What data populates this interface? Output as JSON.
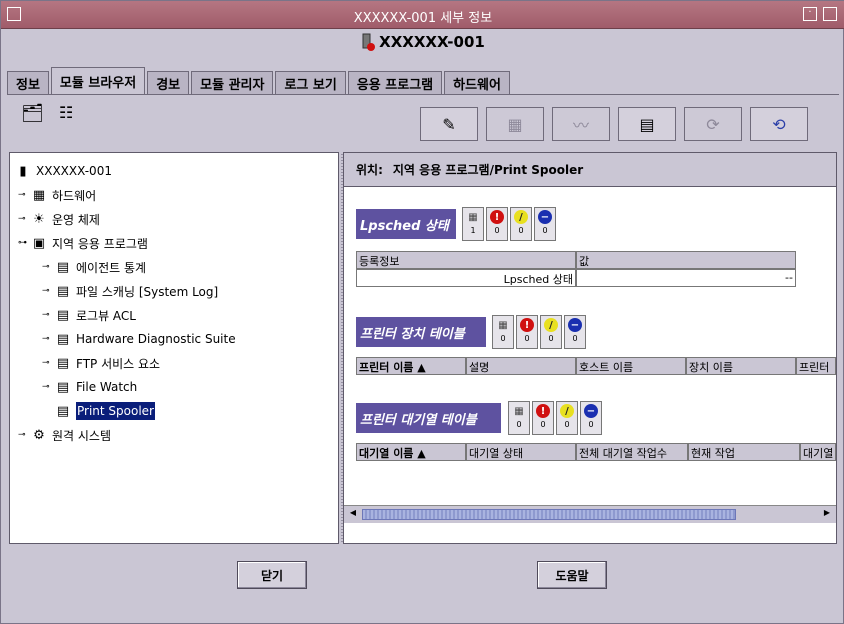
{
  "window": {
    "title": "XXXXXX-001 세부 정보"
  },
  "header": {
    "host": "XXXXXX-001"
  },
  "tabs": [
    {
      "label": "정보"
    },
    {
      "label": "모듈 브라우저"
    },
    {
      "label": "경보"
    },
    {
      "label": "모듈 관리자"
    },
    {
      "label": "로그 보기"
    },
    {
      "label": "응용 프로그램"
    },
    {
      "label": "하드웨어"
    }
  ],
  "tree": {
    "items": [
      {
        "label": "XXXXXX-001"
      },
      {
        "label": "하드웨어"
      },
      {
        "label": "운영 체제"
      },
      {
        "label": "지역 응용 프로그램"
      },
      {
        "label": "에이전트 통계"
      },
      {
        "label": "파일 스캐닝 [System Log]"
      },
      {
        "label": "로그뷰 ACL"
      },
      {
        "label": "Hardware Diagnostic Suite"
      },
      {
        "label": "FTP 서비스 요소"
      },
      {
        "label": "File Watch"
      },
      {
        "label": "Print Spooler"
      },
      {
        "label": "원격 시스템"
      }
    ]
  },
  "location": {
    "label": "위치:",
    "path": "지역 응용 프로그램/Print Spooler"
  },
  "sections": [
    {
      "title": "Lpsched 상태",
      "counts": [
        "1",
        "0",
        "0",
        "0"
      ],
      "headers": [
        "등록정보",
        "값"
      ],
      "row": [
        "Lpsched 상태",
        "--"
      ]
    },
    {
      "title": "프린터 장치 테이블",
      "counts": [
        "0",
        "0",
        "0",
        "0"
      ],
      "headers": [
        "프린터 이름 ▲",
        "설명",
        "호스트 이름",
        "장치 이름",
        "프린터"
      ]
    },
    {
      "title": "프린터 대기열 테이블",
      "counts": [
        "0",
        "0",
        "0",
        "0"
      ],
      "headers": [
        "대기열 이름 ▲",
        "대기열 상태",
        "전체 대기열 작업수",
        "현재 작업",
        "대기열"
      ]
    }
  ],
  "buttons": {
    "close": "닫기",
    "help": "도움말"
  }
}
